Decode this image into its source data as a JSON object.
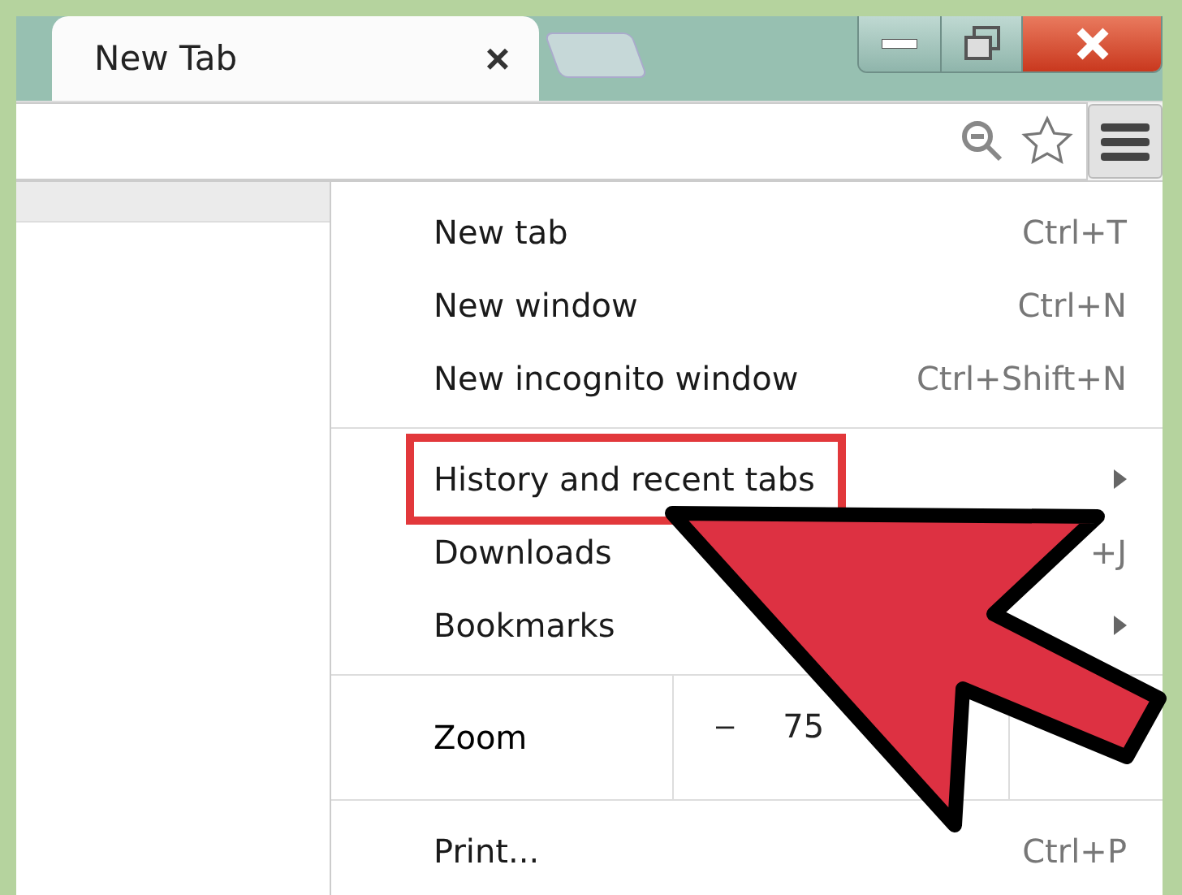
{
  "tab": {
    "title": "New Tab",
    "close": "×"
  },
  "menu": {
    "sections": [
      [
        {
          "kind": "item",
          "label": "New tab",
          "shortcut": "Ctrl+T",
          "submenu": false,
          "highlighted": false
        },
        {
          "kind": "item",
          "label": "New window",
          "shortcut": "Ctrl+N",
          "submenu": false,
          "highlighted": false
        },
        {
          "kind": "item",
          "label": "New incognito window",
          "shortcut": "Ctrl+Shift+N",
          "submenu": false,
          "highlighted": false
        }
      ],
      [
        {
          "kind": "item",
          "label": "History and recent tabs",
          "submenu": true,
          "highlighted": true
        },
        {
          "kind": "item",
          "label": "Downloads",
          "shortcut": "+J",
          "submenu": false,
          "highlighted": false
        },
        {
          "kind": "item",
          "label": "Bookmarks",
          "submenu": true,
          "highlighted": false
        }
      ],
      [
        {
          "kind": "zoom",
          "label": "Zoom",
          "minus": "–",
          "value": "75"
        }
      ],
      [
        {
          "kind": "item",
          "label": "Print...",
          "shortcut": "Ctrl+P",
          "submenu": false,
          "highlighted": false
        }
      ]
    ]
  }
}
